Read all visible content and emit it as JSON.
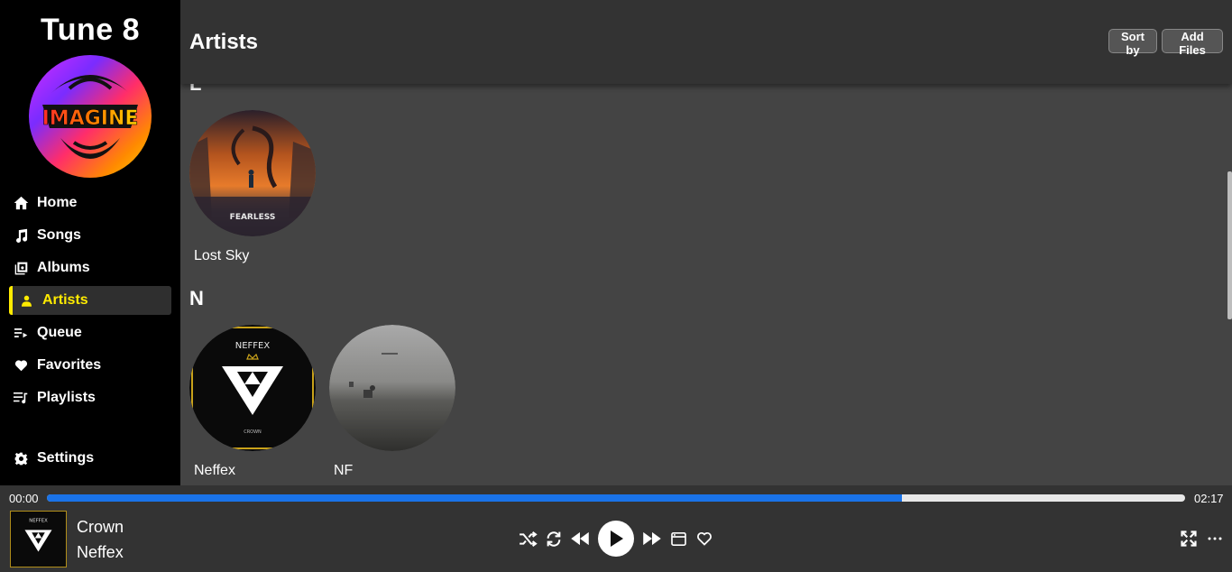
{
  "app": {
    "title": "Tune 8",
    "logo_text": "IMAGINE"
  },
  "sidebar": {
    "items": [
      {
        "label": "Home",
        "icon": "home-icon"
      },
      {
        "label": "Songs",
        "icon": "music-note-icon"
      },
      {
        "label": "Albums",
        "icon": "album-icon"
      },
      {
        "label": "Artists",
        "icon": "person-icon",
        "active": true
      },
      {
        "label": "Queue",
        "icon": "queue-icon"
      },
      {
        "label": "Favorites",
        "icon": "heart-icon"
      },
      {
        "label": "Playlists",
        "icon": "playlist-icon"
      }
    ],
    "settings_label": "Settings"
  },
  "header": {
    "title": "Artists",
    "sort_label": "Sort by",
    "add_label": "Add Files"
  },
  "groups": [
    {
      "letter": "L",
      "artists": [
        {
          "name": "Lost Sky",
          "cover_text": "FEARLESS"
        }
      ]
    },
    {
      "letter": "N",
      "artists": [
        {
          "name": "Neffex",
          "cover_text": "NEFFEX",
          "cover_sub": "CROWN"
        },
        {
          "name": "NF"
        }
      ]
    }
  ],
  "player": {
    "current_time": "00:00",
    "total_time": "02:17",
    "progress": 0.751,
    "track_title": "Crown",
    "track_artist": "Neffex",
    "cover_text": "NEFFEX"
  },
  "colors": {
    "accent": "#ffeb00",
    "progress": "#1a73e8",
    "sidebar": "#000000",
    "main": "#444444"
  }
}
